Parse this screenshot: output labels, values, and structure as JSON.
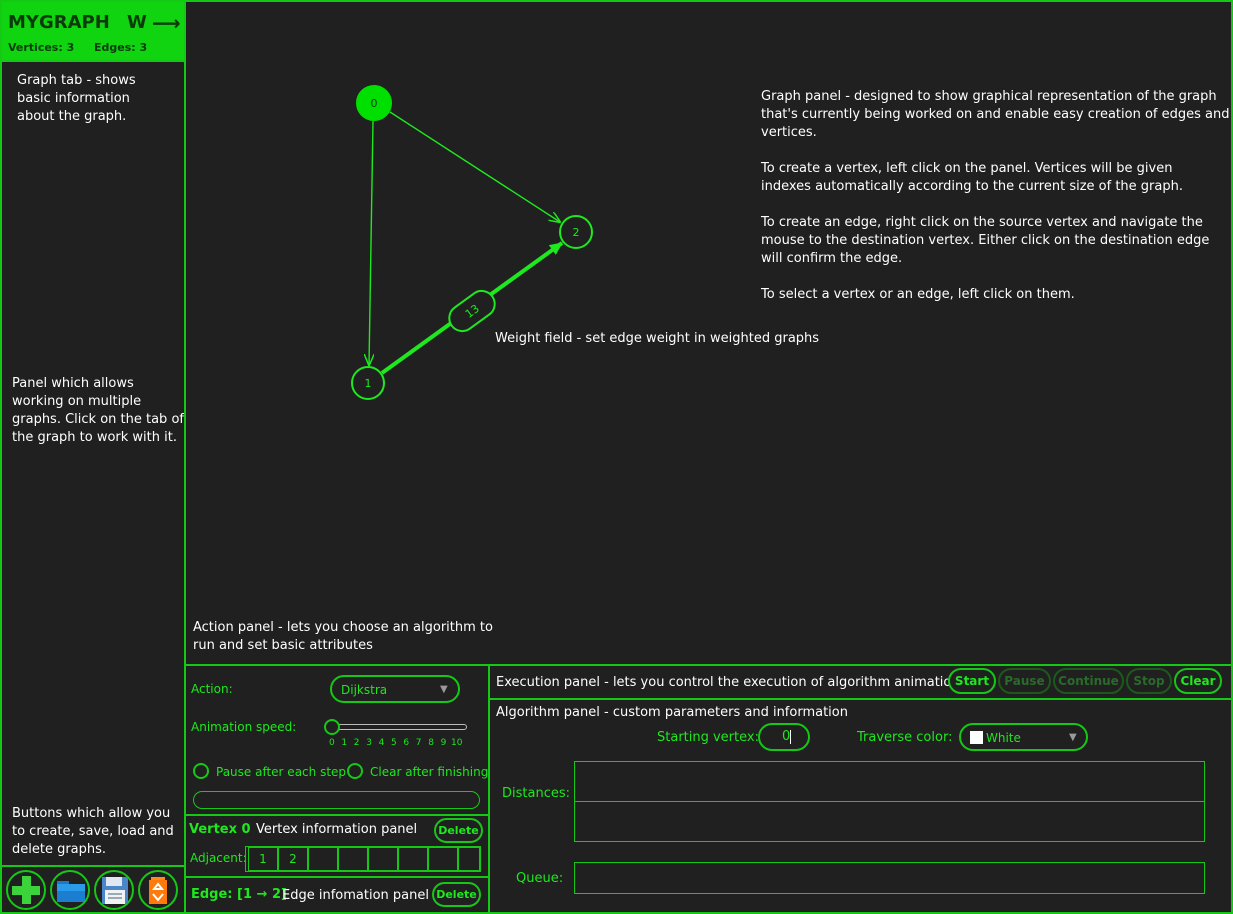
{
  "sidebar": {
    "tab": {
      "title": "MYGRAPH",
      "letter": "W",
      "arrow": "⟶",
      "vertices": "Vertices: 3",
      "edges": "Edges: 3"
    },
    "note_tab": [
      "Graph tab - shows",
      "basic information",
      "about the graph."
    ],
    "note_panel": [
      "Panel which allows",
      "working on multiple",
      "graphs. Click on the tab of",
      "the graph to work with it."
    ],
    "note_buttons": [
      "Buttons which allow you",
      "to create, save, load and",
      "delete graphs."
    ],
    "buttons": [
      {
        "name": "new-graph",
        "icon": "plus-icon"
      },
      {
        "name": "load-graph",
        "icon": "folder-icon"
      },
      {
        "name": "save-graph",
        "icon": "floppy-disk-icon"
      },
      {
        "name": "delete-graph",
        "icon": "recycle-bin-icon"
      }
    ]
  },
  "graph": {
    "vertices": [
      {
        "id": "0",
        "selected": true
      },
      {
        "id": "1",
        "selected": false
      },
      {
        "id": "2",
        "selected": false
      }
    ],
    "edges": [
      {
        "from": "0",
        "to": "2",
        "weight": null,
        "selected": false
      },
      {
        "from": "0",
        "to": "1",
        "weight": null,
        "selected": false
      },
      {
        "from": "1",
        "to": "2",
        "weight": "13",
        "selected": true
      }
    ],
    "note_graph": [
      "Graph panel - designed to show graphical representation of the graph",
      "that's currently being worked on and enable easy creation of edges and",
      "vertices.",
      "",
      "To create a vertex, left click on the panel. Vertices will be given",
      "indexes automatically according to the current size of the graph.",
      "",
      "To create an edge, right click on the source vertex and navigate the",
      "mouse to the destination vertex. Either click on the destination edge",
      "will confirm the edge.",
      "",
      "To select a vertex or an edge, left click on them."
    ],
    "note_weight": "Weight field - set edge weight in weighted graphs",
    "note_action": [
      "Action panel - lets you choose an algorithm to",
      "run and set basic attributes"
    ]
  },
  "action": {
    "action_label": "Action:",
    "action_value": "Dijkstra",
    "speed_label": "Animation speed:",
    "speed_value": 0,
    "speed_ticks": [
      "0",
      "1",
      "2",
      "3",
      "4",
      "5",
      "6",
      "7",
      "8",
      "9",
      "10"
    ],
    "pause_label": "Pause after each step",
    "clear_label": "Clear after finishing",
    "progress": 0
  },
  "vertex_panel": {
    "title": "Vertex 0",
    "note": "Vertex information panel",
    "delete": "Delete",
    "adjacent_label": "Adjacent:",
    "adjacent": [
      "1",
      "2",
      "",
      "",
      "",
      "",
      "",
      ""
    ]
  },
  "edge_panel": {
    "title": "Edge: [1 → 2]",
    "note": "Edge infomation panel",
    "delete": "Delete"
  },
  "execution": {
    "note": "Execution panel - lets you control the execution of algorithm animation",
    "buttons": [
      {
        "label": "Start",
        "enabled": true
      },
      {
        "label": "Pause",
        "enabled": false
      },
      {
        "label": "Continue",
        "enabled": false
      },
      {
        "label": "Stop",
        "enabled": false
      },
      {
        "label": "Clear",
        "enabled": true
      }
    ]
  },
  "algorithm": {
    "note": "Algorithm panel - custom parameters and information",
    "start_label": "Starting vertex:",
    "start_value": "0",
    "color_label": "Traverse color:",
    "color_value": "White",
    "distances_label": "Distances:",
    "queue_label": "Queue:"
  },
  "colors": {
    "accent": "#16c816",
    "text_green": "#1ee81e",
    "background": "#202020",
    "selected_vertex": "#00e000",
    "tab_bg": "#0fd40f",
    "disabled": "#2a6a2a"
  }
}
